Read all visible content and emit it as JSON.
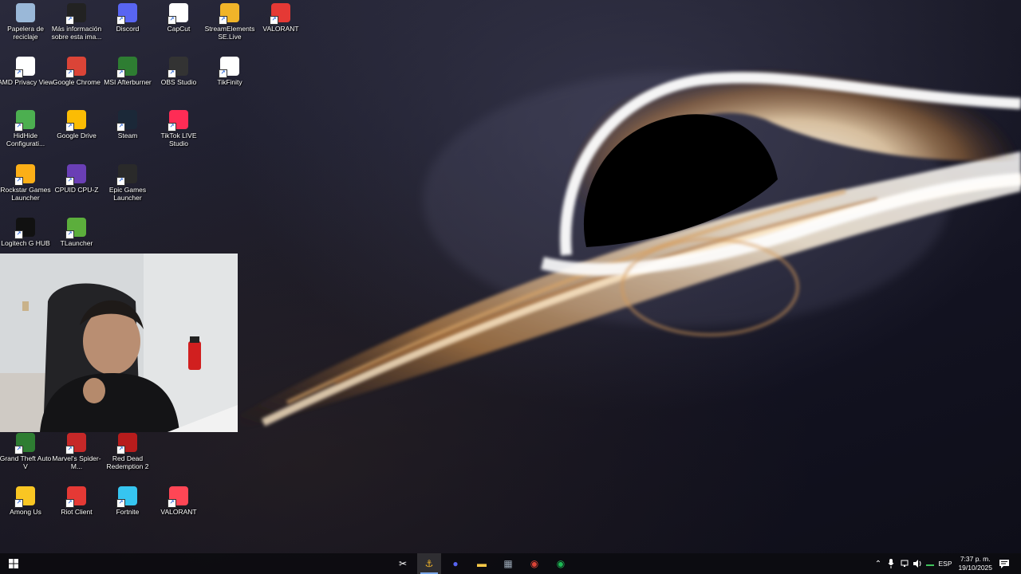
{
  "desktop_icons": [
    {
      "label": "Papelera de reciclaje",
      "icon": "recycle-bin-icon",
      "color": "#9ab8d8"
    },
    {
      "label": "Más información sobre esta ima...",
      "icon": "info-camera-icon",
      "color": "#222222"
    },
    {
      "label": "Discord",
      "icon": "discord-icon",
      "color": "#5865f2"
    },
    {
      "label": "CapCut",
      "icon": "capcut-icon",
      "color": "#ffffff"
    },
    {
      "label": "StreamElements SE.Live",
      "icon": "streamelements-icon",
      "color": "#f0b429"
    },
    {
      "label": "VALORANT",
      "icon": "valorant-icon",
      "color": "#e53935"
    },
    {
      "label": "AMD Privacy View",
      "icon": "amd-icon",
      "color": "#ffffff"
    },
    {
      "label": "Google Chrome",
      "icon": "chrome-icon",
      "color": "#db4437"
    },
    {
      "label": "MSI Afterburner",
      "icon": "afterburner-icon",
      "color": "#2e7d32"
    },
    {
      "label": "OBS Studio",
      "icon": "obs-icon",
      "color": "#333333"
    },
    {
      "label": "TikFinity",
      "icon": "tikfinity-icon",
      "color": "#ffffff"
    },
    {
      "label": "HidHide Configurati...",
      "icon": "hidhide-icon",
      "color": "#4caf50"
    },
    {
      "label": "Google Drive",
      "icon": "google-drive-icon",
      "color": "#fbbc04"
    },
    {
      "label": "Steam",
      "icon": "steam-icon",
      "color": "#1b2838"
    },
    {
      "label": "TikTok LIVE Studio",
      "icon": "tiktok-live-icon",
      "color": "#fe2c55"
    },
    {
      "label": "Rockstar Games Launcher",
      "icon": "rockstar-icon",
      "color": "#fcaf17"
    },
    {
      "label": "CPUID CPU-Z",
      "icon": "cpuz-icon",
      "color": "#6a3fb5"
    },
    {
      "label": "Epic Games Launcher",
      "icon": "epic-games-icon",
      "color": "#2a2a2a"
    },
    {
      "label": "Logitech G HUB",
      "icon": "logitech-icon",
      "color": "#111111"
    },
    {
      "label": "TLauncher",
      "icon": "tlauncher-icon",
      "color": "#5cae3c"
    },
    {
      "label": "Grand Theft Auto V",
      "icon": "gta-v-icon",
      "color": "#2e7d32"
    },
    {
      "label": "Marvel's Spider-M...",
      "icon": "spiderman-icon",
      "color": "#c62828"
    },
    {
      "label": "Red Dead Redemption 2",
      "icon": "rdr2-icon",
      "color": "#b71c1c"
    },
    {
      "label": "Among Us",
      "icon": "among-us-icon",
      "color": "#f9c623"
    },
    {
      "label": "Riot Client",
      "icon": "riot-client-icon",
      "color": "#e53935"
    },
    {
      "label": "Fortnite",
      "icon": "fortnite-icon",
      "color": "#36c5f0"
    },
    {
      "label": "VALORANT",
      "icon": "valorant-icon",
      "color": "#ff4655"
    }
  ],
  "taskbar": {
    "start_icon": "windows-start-icon",
    "pinned": [
      {
        "icon": "capcut-icon",
        "glyph": "✂",
        "active": false
      },
      {
        "icon": "streamelements-icon",
        "glyph": "⚓",
        "active": true
      },
      {
        "icon": "discord-icon",
        "glyph": "●",
        "active": false
      },
      {
        "icon": "file-explorer-icon",
        "glyph": "▬",
        "active": false
      },
      {
        "icon": "calculator-icon",
        "glyph": "▦",
        "active": false
      },
      {
        "icon": "chrome-icon",
        "glyph": "◉",
        "active": false
      },
      {
        "icon": "spotify-icon",
        "glyph": "◉",
        "active": false
      }
    ],
    "tray": {
      "language": "ESP",
      "time": "7:37 p. m.",
      "date": "19/10/2025"
    }
  }
}
